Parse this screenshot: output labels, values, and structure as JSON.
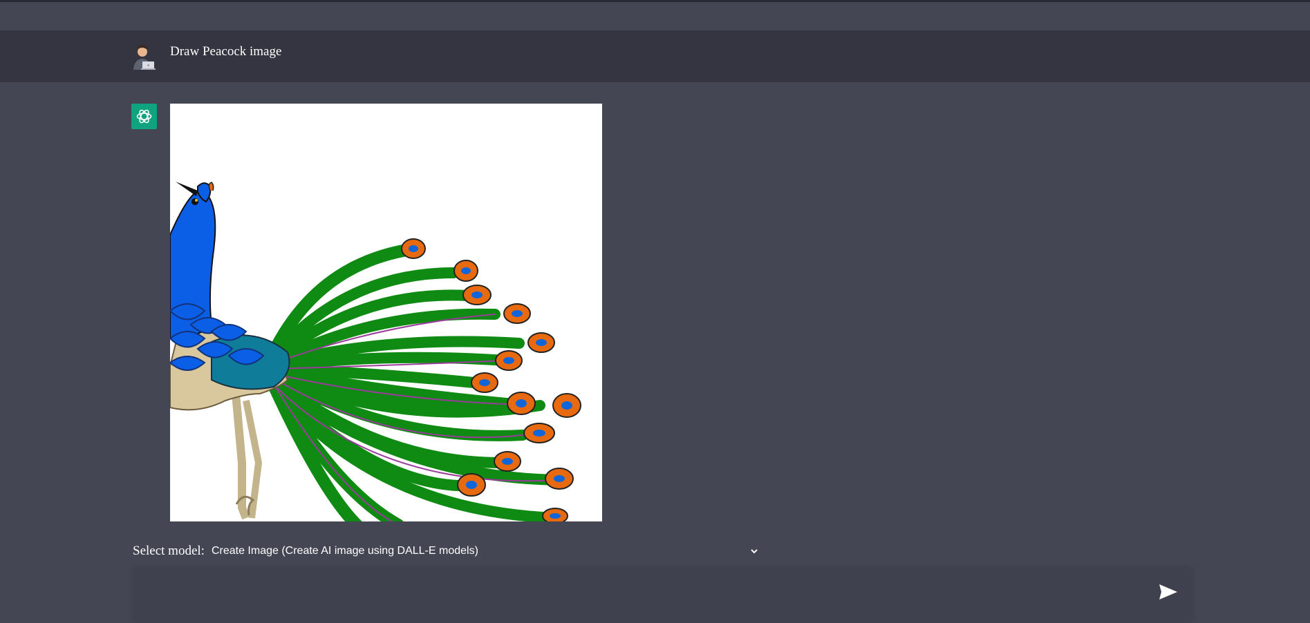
{
  "conversation": {
    "user_message": "Draw Peacock image",
    "user_avatar_icon": "user-avatar-icon",
    "assistant_avatar_icon": "openai-logo-icon",
    "assistant_image_subject": "peacock illustration"
  },
  "composer": {
    "model_label": "Select model:",
    "model_selected": "Create Image (Create AI image using DALL-E models)",
    "input_value": "",
    "send_icon": "send-icon"
  },
  "colors": {
    "page_bg": "#444654",
    "user_row_bg": "#343541",
    "assistant_avatar_bg": "#10a37f",
    "input_bg": "#40414f"
  }
}
